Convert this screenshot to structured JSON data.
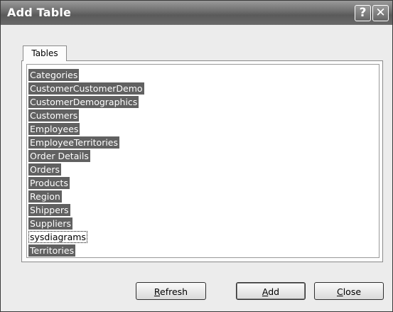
{
  "window": {
    "title": "Add Table",
    "help_glyph": "?",
    "close_glyph": "✕"
  },
  "tabs": [
    {
      "label": "Tables",
      "active": true
    }
  ],
  "tables": [
    {
      "name": "Categories",
      "selected": true
    },
    {
      "name": "CustomerCustomerDemo",
      "selected": true
    },
    {
      "name": "CustomerDemographics",
      "selected": true
    },
    {
      "name": "Customers",
      "selected": true
    },
    {
      "name": "Employees",
      "selected": true
    },
    {
      "name": "EmployeeTerritories",
      "selected": true
    },
    {
      "name": "Order Details",
      "selected": true
    },
    {
      "name": "Orders",
      "selected": true
    },
    {
      "name": "Products",
      "selected": true
    },
    {
      "name": "Region",
      "selected": true
    },
    {
      "name": "Shippers",
      "selected": true
    },
    {
      "name": "Suppliers",
      "selected": true
    },
    {
      "name": "sysdiagrams",
      "selected": false,
      "focused": true
    },
    {
      "name": "Territories",
      "selected": true
    }
  ],
  "buttons": {
    "refresh": {
      "accel": "R",
      "rest": "efresh"
    },
    "add": {
      "accel": "A",
      "rest": "dd"
    },
    "close": {
      "accel": "C",
      "rest": "lose"
    }
  },
  "colors": {
    "selection": "#616161",
    "titlebar": "#6c6c6c"
  }
}
